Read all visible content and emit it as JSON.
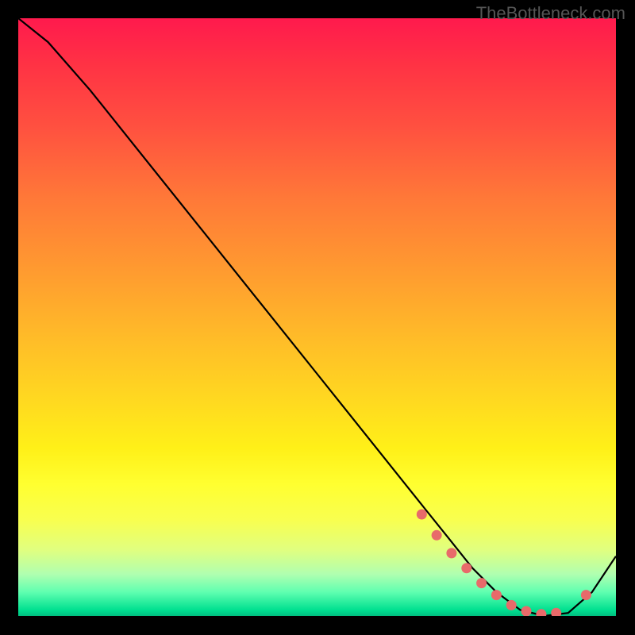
{
  "watermark": "TheBottleneck.com",
  "chart_data": {
    "type": "line",
    "title": "",
    "xlabel": "",
    "ylabel": "",
    "ylim": [
      0,
      100
    ],
    "xlim": [
      0,
      100
    ],
    "series": [
      {
        "name": "curve",
        "x": [
          0,
          5,
          12,
          20,
          30,
          40,
          50,
          60,
          68,
          72,
          76,
          80,
          84,
          88,
          92,
          96,
          100
        ],
        "values": [
          100,
          96,
          88,
          78,
          65.5,
          53,
          40.5,
          28,
          18,
          13,
          8,
          4,
          1,
          0,
          0.5,
          4,
          10
        ]
      }
    ],
    "markers": {
      "name": "highlight-dots",
      "color": "#e86a6a",
      "x": [
        67.5,
        70,
        72.5,
        75,
        77.5,
        80,
        82.5,
        85,
        87.5,
        90,
        95
      ],
      "values": [
        17,
        13.5,
        10.5,
        8,
        5.5,
        3.5,
        1.8,
        0.8,
        0.3,
        0.5,
        3.5
      ]
    },
    "gradient_stops": [
      {
        "pos": 0,
        "color": "#ff1a4d"
      },
      {
        "pos": 50,
        "color": "#ffd000"
      },
      {
        "pos": 85,
        "color": "#ffff50"
      },
      {
        "pos": 100,
        "color": "#00c080"
      }
    ]
  }
}
